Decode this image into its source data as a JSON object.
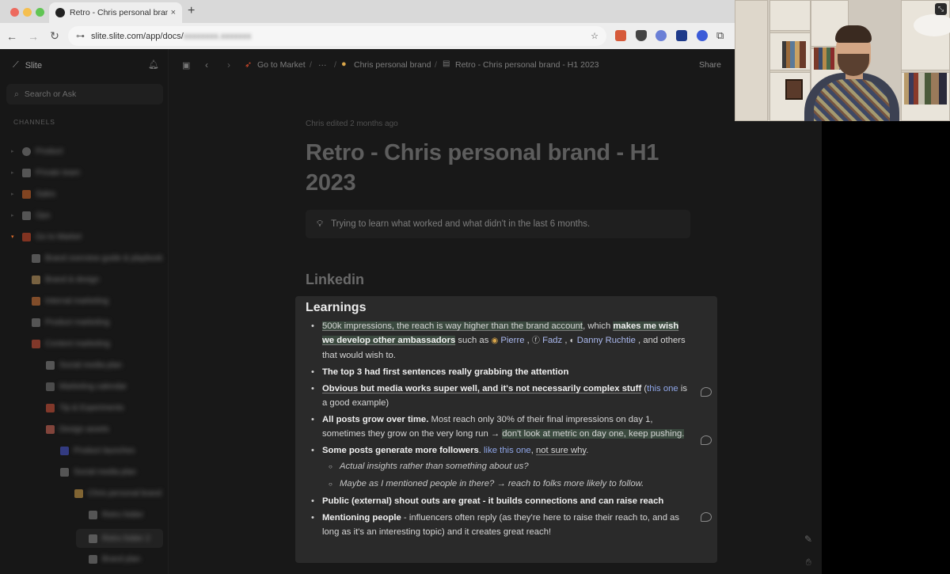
{
  "browser": {
    "tab_title": "Retro - Chris personal brand",
    "tab_close": "×",
    "new_tab": "+",
    "url_visible": "slite.slite.com/app/docs/",
    "url_blurred": "xxxxxxxx.xxxxxxx"
  },
  "app": {
    "brand": "Slite",
    "search_placeholder": "Search or Ask",
    "channels_header": "CHANNELS"
  },
  "breadcrumb": {
    "item1": "Go to Market",
    "sep": "/",
    "ellipsis": "···",
    "item2": "Chris personal brand",
    "item3": "Retro - Chris personal brand - H1 2023"
  },
  "share_label": "Share",
  "doc": {
    "edited": "Chris edited 2 months ago",
    "title": "Retro - Chris personal brand - H1 2023",
    "callout": "Trying to learn what worked and what didn't in the last 6 months.",
    "section": "Linkedin",
    "subsection": "Learnings",
    "b1_a": "500k impressions, the reach is way higher than the brand account",
    "b1_b": ", which ",
    "b1_c": "makes me wish we develop other ambassadors",
    "b1_d": " such as ",
    "mention1": "Pierre",
    "comma": " , ",
    "mention2": "Fadz",
    "mention3": "Danny Ruchtie",
    "b1_e": " , and others that would wish to.",
    "b2": "The top 3 had first sentences really grabbing the attention",
    "b3_a": "Obvious but media works super well, and it's not necessarily complex stuff",
    "b3_b": " (",
    "b3_link": "this one",
    "b3_c": " is a good example)",
    "b4_a": "All posts grow over time.",
    "b4_b": " Most reach only 30% of their final impressions on day 1, sometimes they grow on the very long run → ",
    "b4_c": "don't look at metric on day one, keep pushing.",
    "b5_a": "Some posts generate more followers",
    "b5_b": ". ",
    "b5_link": "like this one",
    "b5_c": ", ",
    "b5_d": "not sure why",
    "b5_e": ".",
    "b5_sub1": "Actual insights rather than something about us?",
    "b5_sub2": "Maybe as I mentioned people in there? → reach to folks more likely to follow.",
    "b6": "Public (external) shout outs are great - it builds connections and can raise reach",
    "b7_a": "Mentioning people",
    "b7_b": " - influencers often reply (as they're here to raise their reach to, and as long as it's an interesting topic) and it creates great reach!"
  },
  "channels_blurred": [
    "Product",
    "Private team",
    "Sales",
    "Ops",
    "Go to Market",
    "Brand overview guide & playbook",
    "Brand & design",
    "Internal marketing",
    "Product marketing",
    "Content marketing",
    "Social media plan",
    "Marketing calendar",
    "Tip & Experiments",
    "Design assets",
    "Product launches",
    "Social media plan",
    "Chris personal brand",
    "Retro folder",
    "Retro folder 2",
    "Brand plan"
  ],
  "colors": {
    "app_bg": "#181818",
    "card_bg": "#2a2a2a",
    "highlight_green": "#3b4a3f",
    "link_blue": "#8fa6e8"
  }
}
